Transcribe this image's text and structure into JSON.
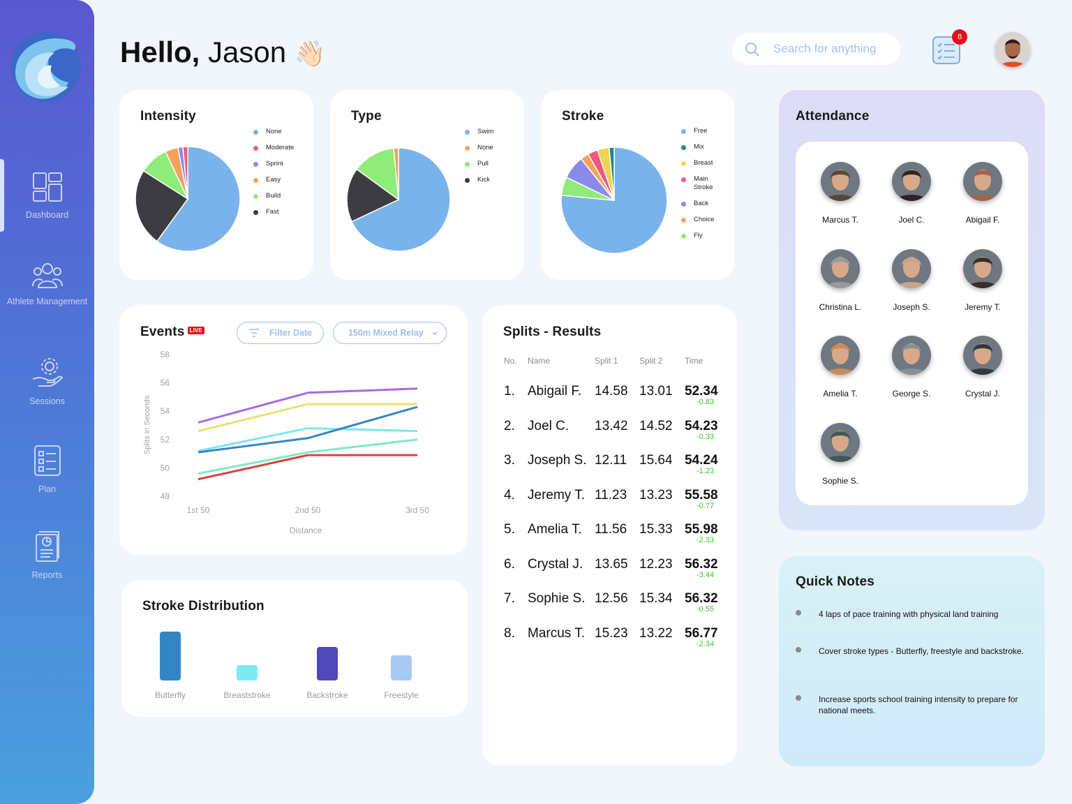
{
  "nav": {
    "items": [
      {
        "label": "Dashboard",
        "icon": "dashboard-icon"
      },
      {
        "label": "Athlete Management",
        "icon": "athletes-icon"
      },
      {
        "label": "Sessions",
        "icon": "sessions-icon"
      },
      {
        "label": "Plan",
        "icon": "plan-icon"
      },
      {
        "label": "Reports",
        "icon": "reports-icon"
      }
    ]
  },
  "header": {
    "hello": "Hello,",
    "name": "Jason",
    "wave": "👋🏻",
    "search_placeholder": "Search for anything",
    "task_badge": "8"
  },
  "intensity": {
    "title": "Intensity",
    "legend": [
      {
        "label": "None",
        "color": "#7ab3ea"
      },
      {
        "label": "Moderate",
        "color": "#ee5a7e"
      },
      {
        "label": "Sprint",
        "color": "#8a8aea"
      },
      {
        "label": "Easy",
        "color": "#f4a25a"
      },
      {
        "label": "Build",
        "color": "#8feb7a"
      },
      {
        "label": "Fast",
        "color": "#3c3c42"
      }
    ]
  },
  "type": {
    "title": "Type",
    "legend": [
      {
        "label": "Swim",
        "color": "#7ab3ea"
      },
      {
        "label": "None",
        "color": "#f4a25a"
      },
      {
        "label": "Pull",
        "color": "#8feb7a"
      },
      {
        "label": "Kick",
        "color": "#3c3c42"
      }
    ]
  },
  "stroke": {
    "title": "Stroke",
    "legend": [
      {
        "label": "Free",
        "color": "#7ab3ea"
      },
      {
        "label": "Mix",
        "color": "#1a8a8a"
      },
      {
        "label": "Breast",
        "color": "#f0d350"
      },
      {
        "label": "Main Stroke",
        "color": "#ee5a7e"
      },
      {
        "label": "Back",
        "color": "#8a8aea"
      },
      {
        "label": "Choice",
        "color": "#f4a25a"
      },
      {
        "label": "Fly",
        "color": "#8feb7a"
      }
    ]
  },
  "events": {
    "title": "Events",
    "live": "LIVE",
    "filter_label": "Filter Date",
    "event_select": "150m Mixed Relay",
    "ylabel": "Splits in Seconds",
    "xlabel": "Distance"
  },
  "chart_data": [
    {
      "type": "pie",
      "title": "Intensity",
      "labels": [
        "None",
        "Fast",
        "Build",
        "Easy",
        "Sprint",
        "Moderate"
      ],
      "values": [
        60,
        24,
        9,
        4,
        1.5,
        1.5
      ]
    },
    {
      "type": "pie",
      "title": "Type",
      "labels": [
        "Swim",
        "Kick",
        "Pull",
        "None"
      ],
      "values": [
        68,
        17,
        13.5,
        1.5
      ]
    },
    {
      "type": "pie",
      "title": "Stroke",
      "labels": [
        "Free",
        "Fly",
        "Back",
        "Choice",
        "Main Stroke",
        "Breast",
        "Mix"
      ],
      "values": [
        75,
        5.5,
        7,
        2.5,
        3,
        3.5,
        1.5
      ]
    },
    {
      "type": "line",
      "x": [
        "1st 50",
        "2nd 50",
        "3rd 50"
      ],
      "ylim": [
        48,
        58
      ],
      "yticks": [
        48,
        50,
        52,
        54,
        56,
        58
      ],
      "series": [
        {
          "color": "#a56ae8",
          "values": [
            53.2,
            55.3,
            55.6
          ]
        },
        {
          "color": "#ece070",
          "values": [
            52.6,
            54.5,
            54.5
          ]
        },
        {
          "color": "#7de6ee",
          "values": [
            51.2,
            52.8,
            52.6
          ]
        },
        {
          "color": "#3386c6",
          "values": [
            51.1,
            52.1,
            54.3
          ]
        },
        {
          "color": "#7eebc2",
          "values": [
            49.6,
            51.1,
            52.0
          ]
        },
        {
          "color": "#dd4040",
          "values": [
            49.2,
            50.9,
            50.9
          ]
        }
      ]
    },
    {
      "type": "bar",
      "title": "Stroke Distribution",
      "categories": [
        "Butterfly",
        "Breaststroke",
        "Backstroke",
        "Freestyle"
      ],
      "values": [
        70,
        22,
        48,
        36
      ],
      "colors": [
        "#3386c6",
        "#7ceaf0",
        "#5047b8",
        "#a7c9f4"
      ]
    }
  ],
  "splits": {
    "title": "Splits - Results",
    "headers": [
      "No.",
      "Name",
      "Split 1",
      "Split 2",
      "Time"
    ],
    "rows": [
      {
        "no": "1.",
        "name": "Abigail F.",
        "s1": "14.58",
        "s2": "13.01",
        "time": "52.34",
        "delta": "-0.83"
      },
      {
        "no": "2.",
        "name": "Joel C.",
        "s1": "13.42",
        "s2": "14.52",
        "time": "54.23",
        "delta": "-0.33"
      },
      {
        "no": "3.",
        "name": "Joseph S.",
        "s1": "12.11",
        "s2": "15.64",
        "time": "54.24",
        "delta": "-1.23"
      },
      {
        "no": "4.",
        "name": "Jeremy T.",
        "s1": "11.23",
        "s2": "13.23",
        "time": "55.58",
        "delta": "-0.77"
      },
      {
        "no": "5.",
        "name": "Amelia T.",
        "s1": "11.56",
        "s2": "15.33",
        "time": "55.98",
        "delta": "-2.33"
      },
      {
        "no": "6.",
        "name": "Crystal J.",
        "s1": "13.65",
        "s2": "12.23",
        "time": "56.32",
        "delta": "-3.44"
      },
      {
        "no": "7.",
        "name": "Sophie S.",
        "s1": "12.56",
        "s2": "15.34",
        "time": "56.32",
        "delta": "-0.55"
      },
      {
        "no": "8.",
        "name": "Marcus T.",
        "s1": "15.23",
        "s2": "13.22",
        "time": "56.77",
        "delta": "-2.34"
      }
    ]
  },
  "attendance": {
    "title": "Attendance",
    "people": [
      {
        "name": "Marcus T.",
        "color": "#5b4636"
      },
      {
        "name": "Joel C.",
        "color": "#2f2420"
      },
      {
        "name": "Abigail F.",
        "color": "#a0644e"
      },
      {
        "name": "Christina L.",
        "color": "#9a9a9a"
      },
      {
        "name": "Joseph S.",
        "color": "#c9a58a"
      },
      {
        "name": "Jeremy T.",
        "color": "#3a2c28"
      },
      {
        "name": "Amelia T.",
        "color": "#c98a56"
      },
      {
        "name": "George S.",
        "color": "#8a8f96"
      },
      {
        "name": "Crystal J.",
        "color": "#2d3a3e"
      },
      {
        "name": "Sophie S.",
        "color": "#3f5a55"
      }
    ]
  },
  "notes": {
    "title": "Quick Notes",
    "items": [
      "4 laps of pace training with physical land training",
      "Cover stroke types - Butterfly, freestyle and backstroke.",
      "Increase sports school training intensity to prepare for national meets."
    ]
  }
}
